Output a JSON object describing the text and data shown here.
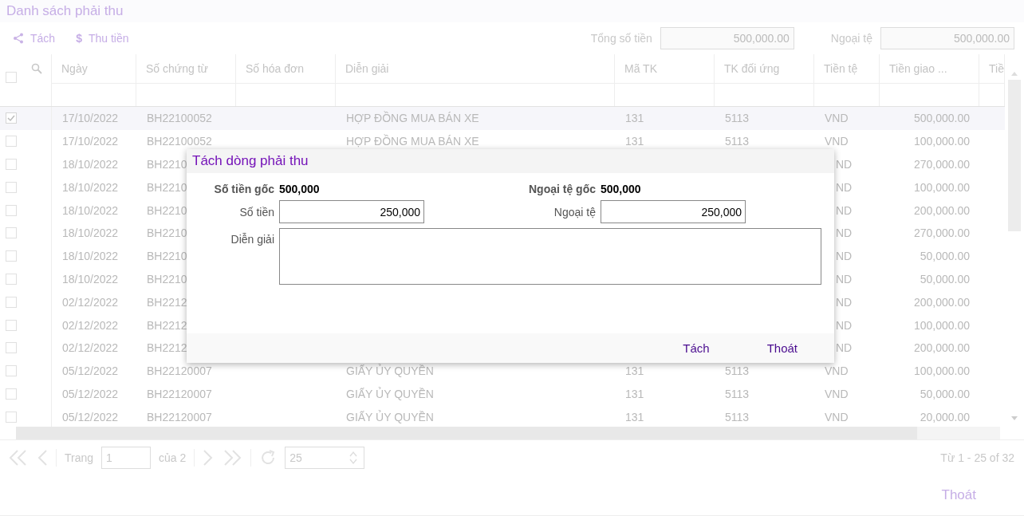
{
  "title": "Danh sách phải thu",
  "toolbar": {
    "actions": [
      {
        "kind": "split",
        "label": "Tách"
      },
      {
        "kind": "collect",
        "icon": "$",
        "label": "Thu tiền"
      }
    ],
    "totals": [
      {
        "label": "Tổng số tiền",
        "value": "500,000.00"
      },
      {
        "label": "Ngoại tệ",
        "value": "500,000.00"
      }
    ]
  },
  "table": {
    "select_all": {
      "checked": false
    },
    "columns": [
      "Ngày",
      "Số chứng từ",
      "Số hóa đơn",
      "Diễn giải",
      "Mã TK",
      "TK đối ứng",
      "Tiền tệ",
      "Tiền giao ...",
      "Tiề"
    ],
    "rows": [
      {
        "kind": "full",
        "selected": true,
        "date": "17/10/2022",
        "voucher": "BH22100052",
        "description": "HỢP ĐỒNG MUA BÁN XE",
        "account": "131",
        "contra_account": "5113",
        "currency": "VND",
        "amount": "500,000.00"
      },
      {
        "kind": "full",
        "selected": false,
        "date": "17/10/2022",
        "voucher": "BH22100052",
        "description": "HỢP ĐỒNG MUA BÁN XE",
        "account": "131",
        "contra_account": "5113",
        "currency": "VND",
        "amount": "100,000.00"
      },
      {
        "kind": "under-dialog",
        "selected": false,
        "date": "18/10/2022",
        "voucher": "BH2210",
        "currency": "ND",
        "amount": "270,000.00"
      },
      {
        "kind": "under-dialog",
        "selected": false,
        "date": "18/10/2022",
        "voucher": "BH2210",
        "currency": "ND",
        "amount": "100,000.00"
      },
      {
        "kind": "under-dialog",
        "selected": false,
        "date": "18/10/2022",
        "voucher": "BH2210",
        "currency": "ND",
        "amount": "200,000.00"
      },
      {
        "kind": "under-dialog",
        "selected": false,
        "date": "18/10/2022",
        "voucher": "BH2210",
        "currency": "ND",
        "amount": "270,000.00"
      },
      {
        "kind": "under-dialog",
        "selected": false,
        "date": "18/10/2022",
        "voucher": "BH2210",
        "currency": "ND",
        "amount": "50,000.00"
      },
      {
        "kind": "under-dialog",
        "selected": false,
        "date": "18/10/2022",
        "voucher": "BH2210",
        "currency": "ND",
        "amount": "50,000.00"
      },
      {
        "kind": "under-dialog",
        "selected": false,
        "date": "02/12/2022",
        "voucher": "BH2212",
        "currency": "ND",
        "amount": "200,000.00"
      },
      {
        "kind": "under-dialog",
        "selected": false,
        "date": "02/12/2022",
        "voucher": "BH2212",
        "currency": "ND",
        "amount": "100,000.00"
      },
      {
        "kind": "under-dialog",
        "selected": false,
        "date": "02/12/2022",
        "voucher": "BH2212",
        "currency": "ND",
        "amount": "200,000.00"
      },
      {
        "kind": "full",
        "selected": false,
        "date": "05/12/2022",
        "voucher": "BH22120007",
        "description": "GIẤY ỦY QUYỀN",
        "account": "131",
        "contra_account": "5113",
        "currency": "VND",
        "amount": "100,000.00"
      },
      {
        "kind": "full",
        "selected": false,
        "date": "05/12/2022",
        "voucher": "BH22120007",
        "description": "GIẤY ỦY QUYỀN",
        "account": "131",
        "contra_account": "5113",
        "currency": "VND",
        "amount": "50,000.00"
      },
      {
        "kind": "full",
        "selected": false,
        "date": "05/12/2022",
        "voucher": "BH22120007",
        "description": "GIẤY ỦY QUYỀN",
        "account": "131",
        "contra_account": "5113",
        "currency": "VND",
        "amount": "20,000.00"
      }
    ]
  },
  "pager": {
    "page_label": "Trang",
    "page": "1",
    "page_of": "của 2",
    "page_size": "25",
    "range": "Từ 1 - 25 of 32"
  },
  "footer": {
    "close_button": "Thoát"
  },
  "dialog": {
    "title": "Tách dòng phải thu",
    "originals": [
      {
        "label": "Số tiền gốc",
        "value": "500,000"
      },
      {
        "label": "Ngoại tệ gốc",
        "value": "500,000"
      }
    ],
    "fields": [
      {
        "label": "Số tiền",
        "value": "250,000"
      },
      {
        "label": "Ngoại tệ",
        "value": "250,000"
      }
    ],
    "note": {
      "label": "Diễn giải"
    },
    "buttons": [
      "Tách",
      "Thoát"
    ]
  }
}
